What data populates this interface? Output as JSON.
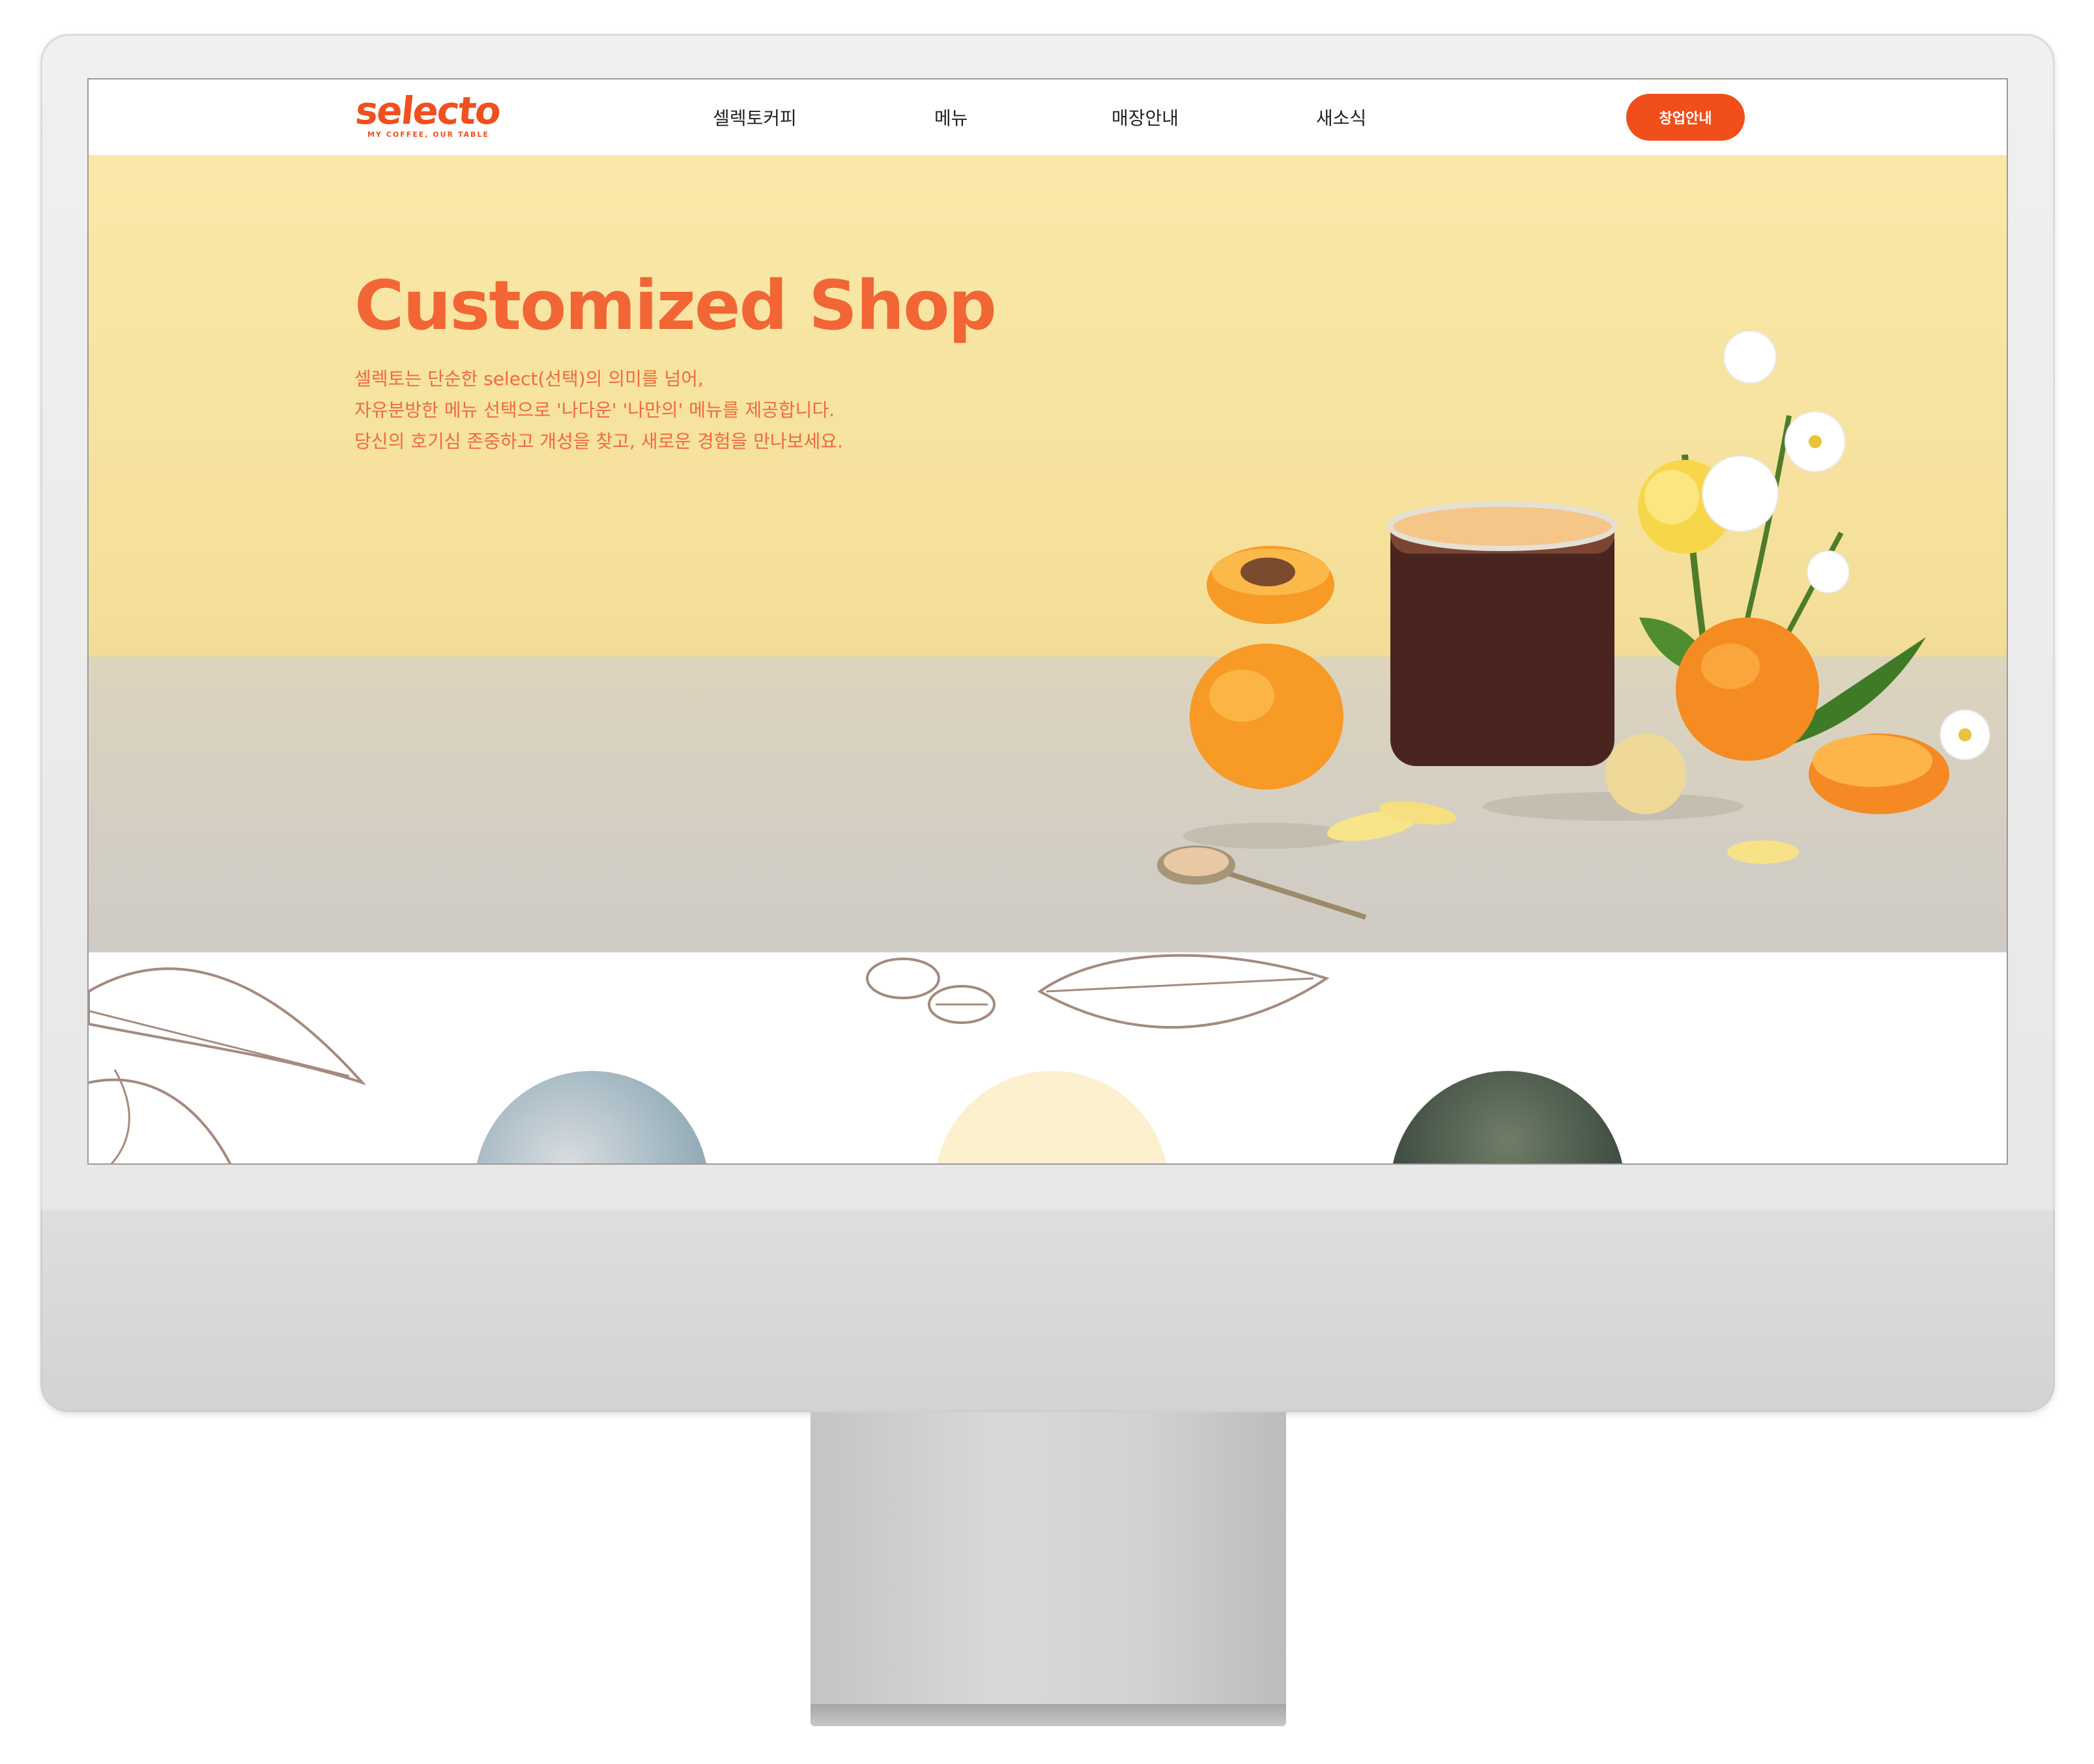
{
  "nav": {
    "logo": "selecto",
    "logo_tagline": "MY COFFEE, OUR TABLE",
    "items": [
      {
        "label": "셀렉토커피"
      },
      {
        "label": "메뉴"
      },
      {
        "label": "매장안내"
      },
      {
        "label": "새소식"
      }
    ],
    "cta_label": "창업안내"
  },
  "hero": {
    "title": "Customized Shop",
    "lines": [
      "셀렉토는 단순한 select(선택)의 의미를 넘어,",
      "자유분방한 메뉴 선택으로 '나다운' '나만의' 메뉴를 제공합니다.",
      "당신의 호기심 존중하고 개성을 찾고, 새로운 경험을 만나보세요."
    ]
  },
  "colors": {
    "brand_orange": "#f04e1a",
    "hero_background": "#f5e09a",
    "hero_text": "#f26535"
  },
  "icons": [
    "coffee-leaf-sketch",
    "coffee-bean-sketch"
  ]
}
